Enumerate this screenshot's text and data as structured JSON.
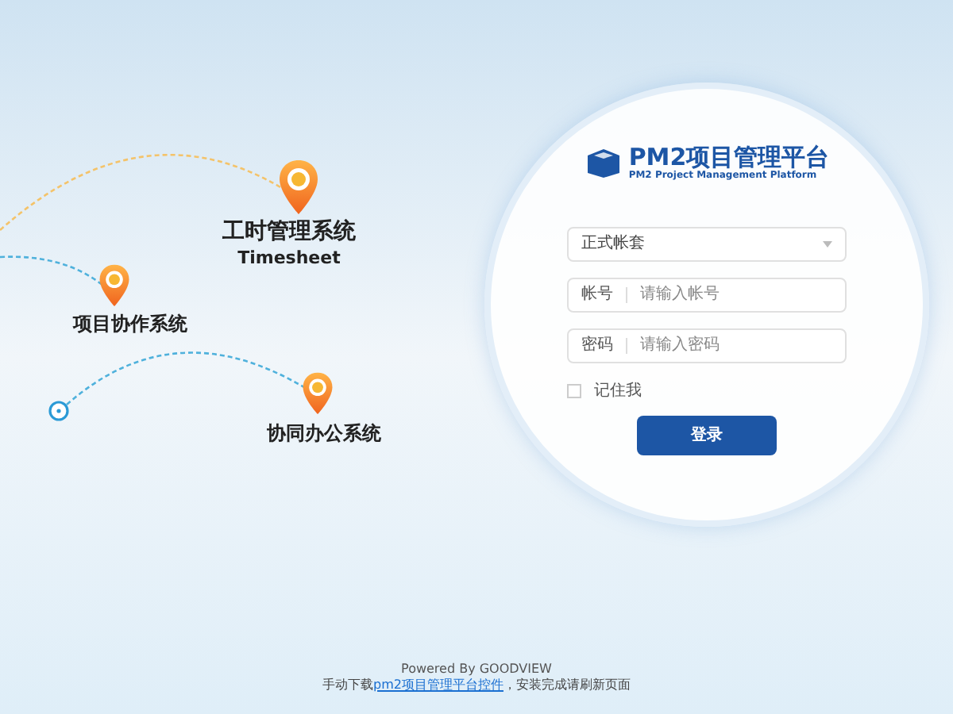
{
  "systems": [
    {
      "name": "工时管理系统",
      "subtitle": "Timesheet"
    },
    {
      "name": "项目协作系统"
    },
    {
      "name": "协同办公系统"
    }
  ],
  "login": {
    "title": "PM2项目管理平台",
    "subtitle": "PM2 Project Management Platform",
    "account_set": {
      "value": "正式帐套"
    },
    "fields": [
      {
        "label": "帐号",
        "placeholder": "请输入帐号"
      },
      {
        "label": "密码",
        "placeholder": "请输入密码"
      }
    ],
    "remember": {
      "label": "记住我",
      "checked": false
    },
    "submit": "登录"
  },
  "footer": {
    "powered": "Powered By GOODVIEW",
    "prefix": "手动下载",
    "link": "pm2项目管理平台控件",
    "suffix": "，安装完成请刷新页面"
  }
}
